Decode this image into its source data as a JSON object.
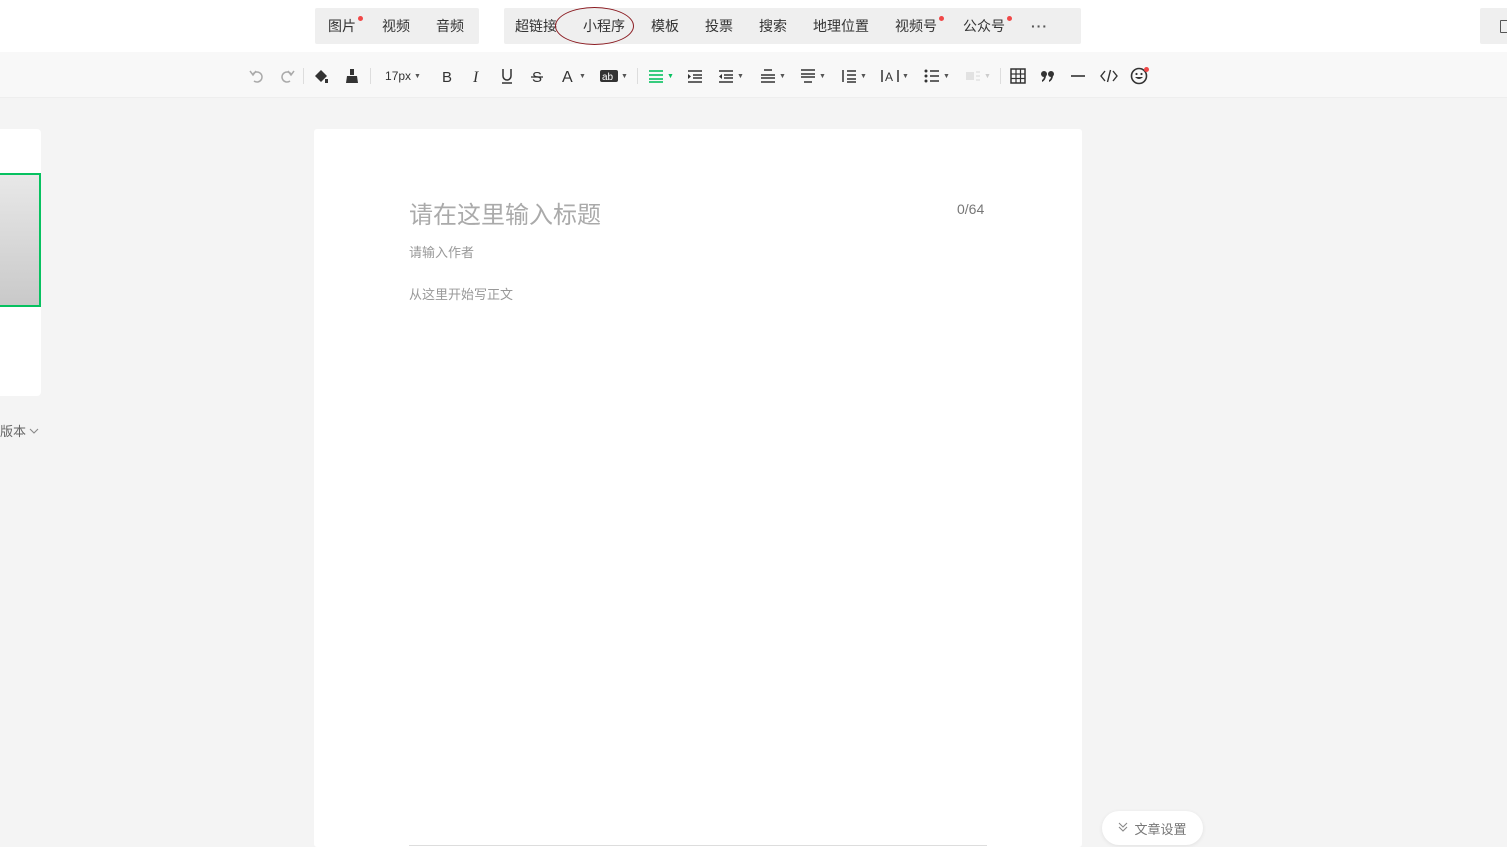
{
  "insert_bar": {
    "media": [
      {
        "label": "图片",
        "dot": true
      },
      {
        "label": "视频",
        "dot": false
      },
      {
        "label": "音频",
        "dot": false
      }
    ],
    "tools": [
      {
        "label": "超链接",
        "dot": false
      },
      {
        "label": "小程序",
        "dot": false
      },
      {
        "label": "模板",
        "dot": false
      },
      {
        "label": "投票",
        "dot": false
      },
      {
        "label": "搜索",
        "dot": false
      },
      {
        "label": "地理位置",
        "dot": false
      },
      {
        "label": "视频号",
        "dot": true
      },
      {
        "label": "公众号",
        "dot": true
      }
    ],
    "more": "···"
  },
  "format_toolbar": {
    "font_size": "17px",
    "active_color": "#07c160",
    "icons": [
      "undo-icon",
      "redo-icon",
      "format-painter-icon",
      "clear-format-icon",
      "font-size-select",
      "bold-icon",
      "italic-icon",
      "underline-icon",
      "strikethrough-icon",
      "font-color-icon",
      "background-color-icon",
      "align-icon",
      "indent-icon",
      "outdent-icon",
      "spacing-top-icon",
      "spacing-bottom-icon",
      "line-height-icon",
      "letter-spacing-icon",
      "list-icon",
      "image-layout-icon",
      "table-icon",
      "quote-icon",
      "divider-icon",
      "code-icon",
      "emoji-icon"
    ]
  },
  "left_panel": {
    "version_label": "版本"
  },
  "editor": {
    "title_placeholder": "请在这里输入标题",
    "title_count": "0/64",
    "author_placeholder": "请输入作者",
    "body_placeholder": "从这里开始写正文"
  },
  "settings_button": {
    "label": "文章设置"
  },
  "colors": {
    "accent_green": "#07c160",
    "red_dot": "#f04848",
    "annotation_circle": "#8b1c22"
  }
}
